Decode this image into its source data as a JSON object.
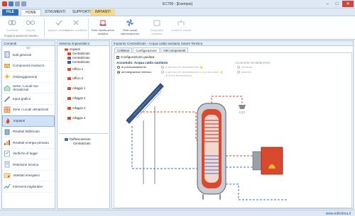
{
  "window": {
    "title": "EC700 - [Esempio]"
  },
  "ribbon_tabs": [
    {
      "label": "FILE"
    },
    {
      "label": "HOME"
    },
    {
      "label": "STRUMENTI"
    },
    {
      "label": "SUPPORTO"
    },
    {
      "label": "IMPIANTI"
    }
  ],
  "ribbon": {
    "buttons": [
      {
        "label": "Combina"
      },
      {
        "label": "Separa"
      },
      {
        "label": "Applica modifiche"
      },
      {
        "label": "Annulla modifiche"
      },
      {
        "label": "Rete distribuzione analitica"
      },
      {
        "label": "Rete canali raffrescamento"
      },
      {
        "label": "Dispositivi impianto"
      },
      {
        "label": "Gestione circuiti"
      }
    ],
    "group_label": "Impianti autonomi Mocleo"
  },
  "sidebar": {
    "header": "Comandi",
    "collapse": "<|>",
    "items": [
      {
        "label": "Dati generali"
      },
      {
        "label": "Componenti involucro"
      },
      {
        "label": "Ombreggiamenti"
      },
      {
        "label": "Serre / Locali non climatizzati"
      },
      {
        "label": "Input grafico"
      },
      {
        "label": "Zone / Locali climatizzati"
      },
      {
        "label": "Impianti"
      },
      {
        "label": "Risultati fabbricato"
      },
      {
        "label": "Risultati energia primaria"
      },
      {
        "label": "Verifiche di legge"
      },
      {
        "label": "Relazione tecnica"
      },
      {
        "label": "Attestati energetici"
      },
      {
        "label": "Interventi migliorativi"
      }
    ]
  },
  "tree": {
    "header": "Sistema impiantistico",
    "root": "Impianti",
    "items": [
      {
        "label": "Centralizzato"
      },
      {
        "label": "Centralizzato"
      },
      {
        "label": "Centralizzato"
      },
      {
        "label": "Ufficio 1"
      },
      {
        "label": "Ufficio 2"
      },
      {
        "label": "Alloggio 1"
      },
      {
        "label": "Alloggio 2"
      },
      {
        "label": "Alloggio 3"
      },
      {
        "label": "Alloggio 4"
      }
    ],
    "cooling_label": "Raffrescamento",
    "cooling_item": "Centralizzato"
  },
  "main": {
    "header": "Impianto Centralizzato - Acqua calda sanitaria Solare Termico",
    "tabs": [
      {
        "label": "Collettori"
      },
      {
        "label": "Configurazione"
      },
      {
        "label": "Altri componenti"
      }
    ],
    "guided_config_label": "Configurazione guidata",
    "guided_config_checked": true,
    "acs_group_title": "Accumulo: Acqua calda sanitaria",
    "acs_options": [
      {
        "label": "di preriscaldamento",
        "selected": false
      },
      {
        "label": "ad integrazione termica",
        "selected": true
      }
    ],
    "service_options": [
      {
        "label": "a servizio di riscaldamento"
      },
      {
        "label": "a servizio di riscaldamento e con accumuli di fluido termovettore"
      }
    ],
    "heating_group_title": "Accumulo riscaldamento",
    "heating_options": [
      {
        "label": "presente"
      },
      {
        "label": "assente"
      }
    ]
  },
  "status": {
    "url": "www.edilclima.it"
  },
  "colors": {
    "accent": "#2f6db5",
    "selection": "#cfe2f7",
    "tank_hot": "#d9492e",
    "boiler": "#d9492e",
    "solar_panel": "#3b5b8c",
    "pipe_hot": "#d9492e",
    "pipe_cold": "#3a6fd0"
  }
}
